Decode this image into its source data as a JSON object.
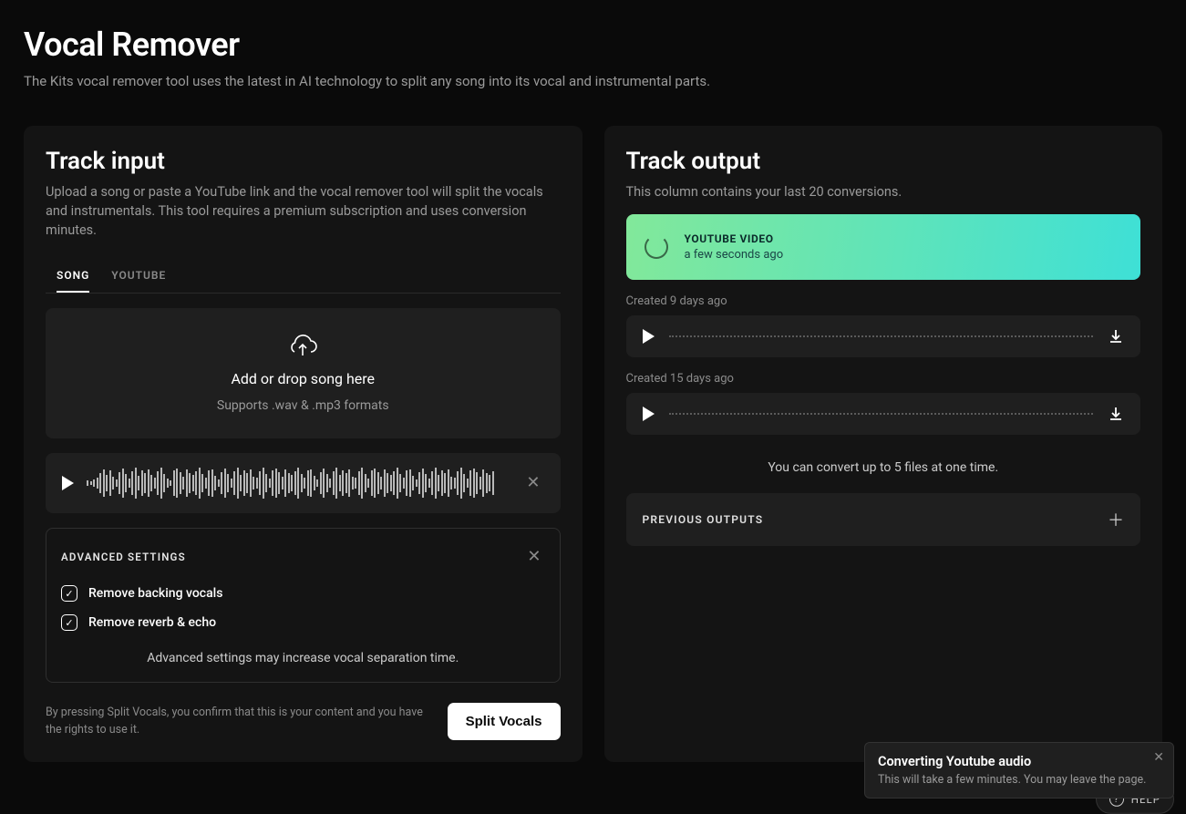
{
  "header": {
    "title": "Vocal Remover",
    "subtitle": "The Kits vocal remover tool uses the latest in AI technology to split any song into its vocal and instrumental parts."
  },
  "input_panel": {
    "title": "Track input",
    "description": "Upload a song or paste a YouTube link and the vocal remover tool will split the vocals and instrumentals. This tool requires a premium subscription and uses conversion minutes.",
    "tabs": {
      "song": "SONG",
      "youtube": "YOUTUBE",
      "active": "song"
    },
    "dropzone": {
      "title": "Add or drop song here",
      "subtitle": "Supports .wav & .mp3 formats"
    },
    "advanced": {
      "title": "ADVANCED SETTINGS",
      "options": [
        {
          "label": "Remove backing vocals",
          "checked": true
        },
        {
          "label": "Remove reverb & echo",
          "checked": true
        }
      ],
      "note": "Advanced settings may increase vocal separation time."
    },
    "disclaimer": "By pressing Split Vocals, you confirm that this is your content and you have the rights to use it.",
    "split_button": "Split Vocals"
  },
  "output_panel": {
    "title": "Track output",
    "description": "This column contains your last 20 conversions.",
    "processing": {
      "label": "YOUTUBE VIDEO",
      "time": "a few seconds ago"
    },
    "conversions": [
      {
        "created": "Created 9 days ago"
      },
      {
        "created": "Created 15 days ago"
      }
    ],
    "limit_note": "You can convert up to 5 files at one time.",
    "previous_outputs_label": "PREVIOUS OUTPUTS"
  },
  "toast": {
    "title": "Converting Youtube audio",
    "subtitle": "This will take a few minutes. You may leave the page."
  },
  "help": {
    "label": "HELP"
  }
}
